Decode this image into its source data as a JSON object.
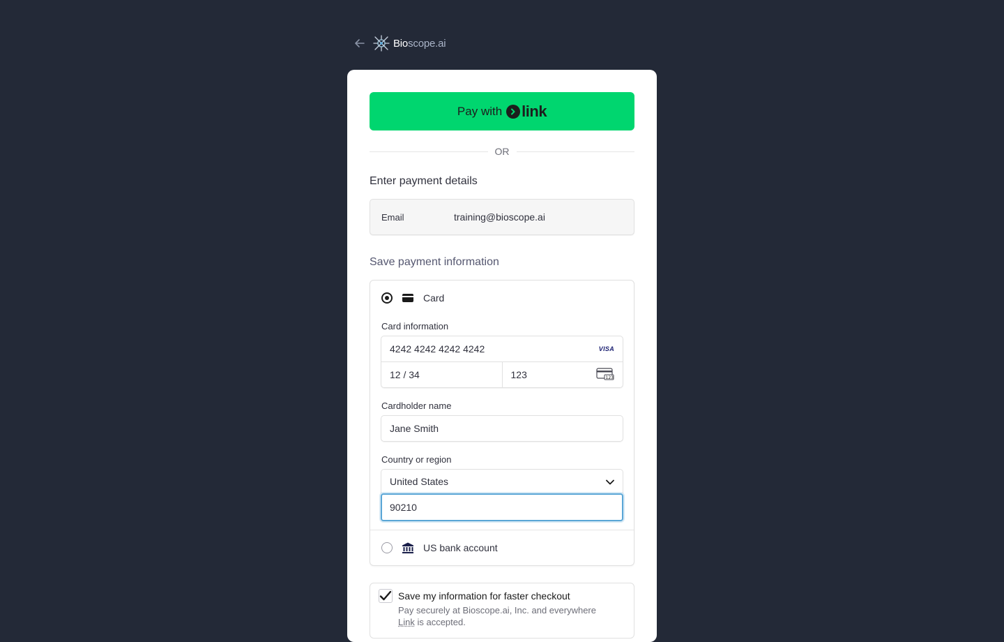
{
  "brand": {
    "name_part1": "Bio",
    "name_part2": "scope.ai"
  },
  "link_button": {
    "prefix": "Pay with",
    "logo_text": "link"
  },
  "divider": {
    "label": "OR"
  },
  "payment": {
    "title": "Enter payment details",
    "email_label": "Email",
    "email_value": "training@bioscope.ai"
  },
  "save_section": {
    "title": "Save payment information"
  },
  "methods": {
    "card": {
      "label": "Card",
      "card_info_label": "Card information",
      "card_number": "4242 4242 4242 4242",
      "card_brand": "VISA",
      "expiry": "12 / 34",
      "cvc": "123",
      "cardholder_label": "Cardholder name",
      "cardholder_value": "Jane Smith",
      "country_label": "Country or region",
      "country_value": "United States",
      "zip_value": "90210"
    },
    "bank": {
      "label": "US bank account"
    }
  },
  "save_info": {
    "title": "Save my information for faster checkout",
    "desc_before": "Pay securely at Bioscope.ai, Inc. and everywhere ",
    "desc_link": "Link",
    "desc_after": " is accepted.",
    "checked": true
  },
  "colors": {
    "background": "#232937",
    "link_green": "#00d66f",
    "focus_blue": "#5aa6d6"
  }
}
